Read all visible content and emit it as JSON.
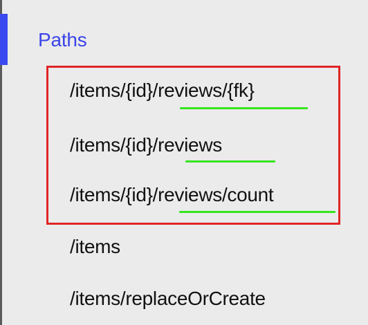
{
  "sidebar": {
    "heading": "Paths",
    "items": [
      {
        "label": "/items/{id}/reviews/{fk}"
      },
      {
        "label": "/items/{id}/reviews"
      },
      {
        "label": "/items/{id}/reviews/count"
      },
      {
        "label": "/items"
      },
      {
        "label": "/items/replaceOrCreate"
      }
    ]
  },
  "colors": {
    "heading": "#3b44e8",
    "active_indicator": "#3a49f0",
    "highlight_box": "#e02424",
    "underline": "#35e51e",
    "text": "#111111",
    "background": "#ebebeb"
  }
}
